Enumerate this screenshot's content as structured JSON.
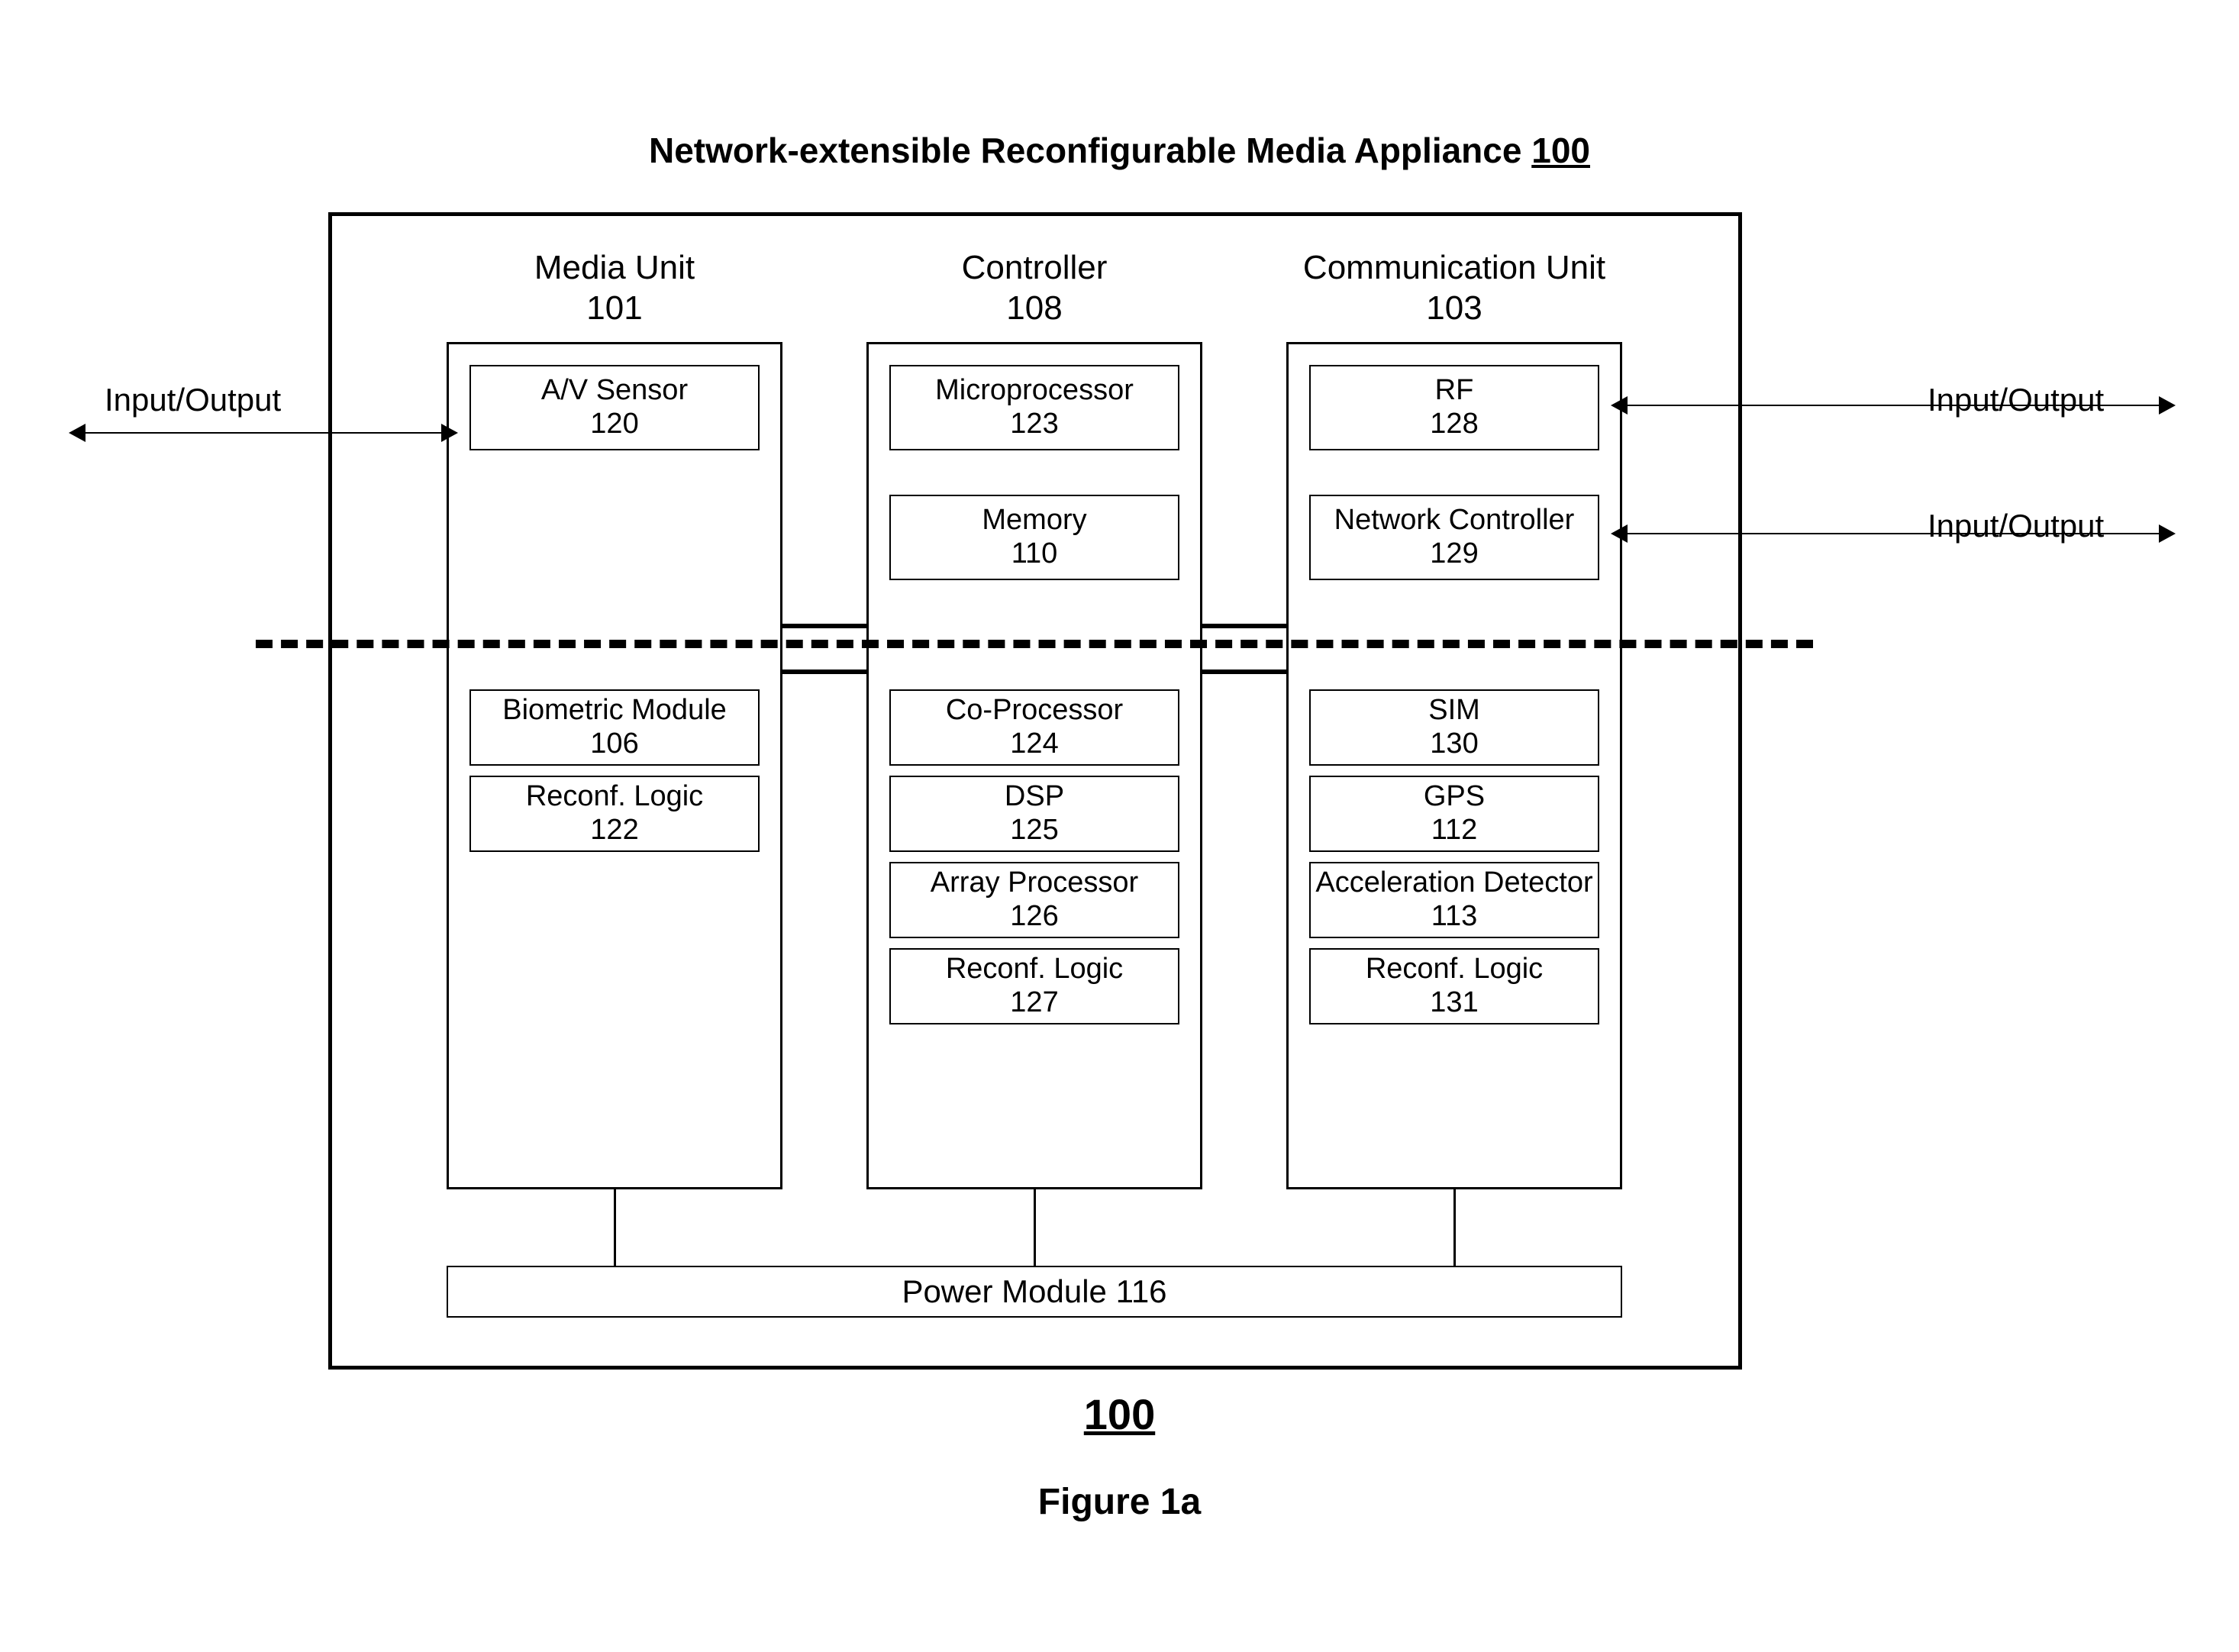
{
  "title": {
    "text": "Network-extensible Reconfigurable Media Appliance",
    "ref": "100"
  },
  "figure": {
    "ref": "100",
    "caption": "Figure 1a"
  },
  "io": {
    "label": "Input/Output"
  },
  "columns": {
    "media": {
      "name": "Media Unit",
      "ref": "101"
    },
    "ctrl": {
      "name": "Controller",
      "ref": "108"
    },
    "comm": {
      "name": "Communication Unit",
      "ref": "103"
    }
  },
  "media": {
    "av": {
      "name": "A/V Sensor",
      "ref": "120"
    },
    "bio": {
      "name": "Biometric Module",
      "ref": "106"
    },
    "reconf": {
      "name": "Reconf. Logic",
      "ref": "122"
    }
  },
  "ctrl": {
    "micro": {
      "name": "Microprocessor",
      "ref": "123"
    },
    "mem": {
      "name": "Memory",
      "ref": "110"
    },
    "cop": {
      "name": "Co-Processor",
      "ref": "124"
    },
    "dsp": {
      "name": "DSP",
      "ref": "125"
    },
    "arr": {
      "name": "Array Processor",
      "ref": "126"
    },
    "reconf": {
      "name": "Reconf. Logic",
      "ref": "127"
    }
  },
  "comm": {
    "rf": {
      "name": "RF",
      "ref": "128"
    },
    "net": {
      "name": "Network Controller",
      "ref": "129"
    },
    "sim": {
      "name": "SIM",
      "ref": "130"
    },
    "gps": {
      "name": "GPS",
      "ref": "112"
    },
    "acc": {
      "name": "Acceleration Detector",
      "ref": "113"
    },
    "reconf": {
      "name": "Reconf. Logic",
      "ref": "131"
    }
  },
  "power": {
    "name": "Power Module",
    "ref": "116"
  }
}
